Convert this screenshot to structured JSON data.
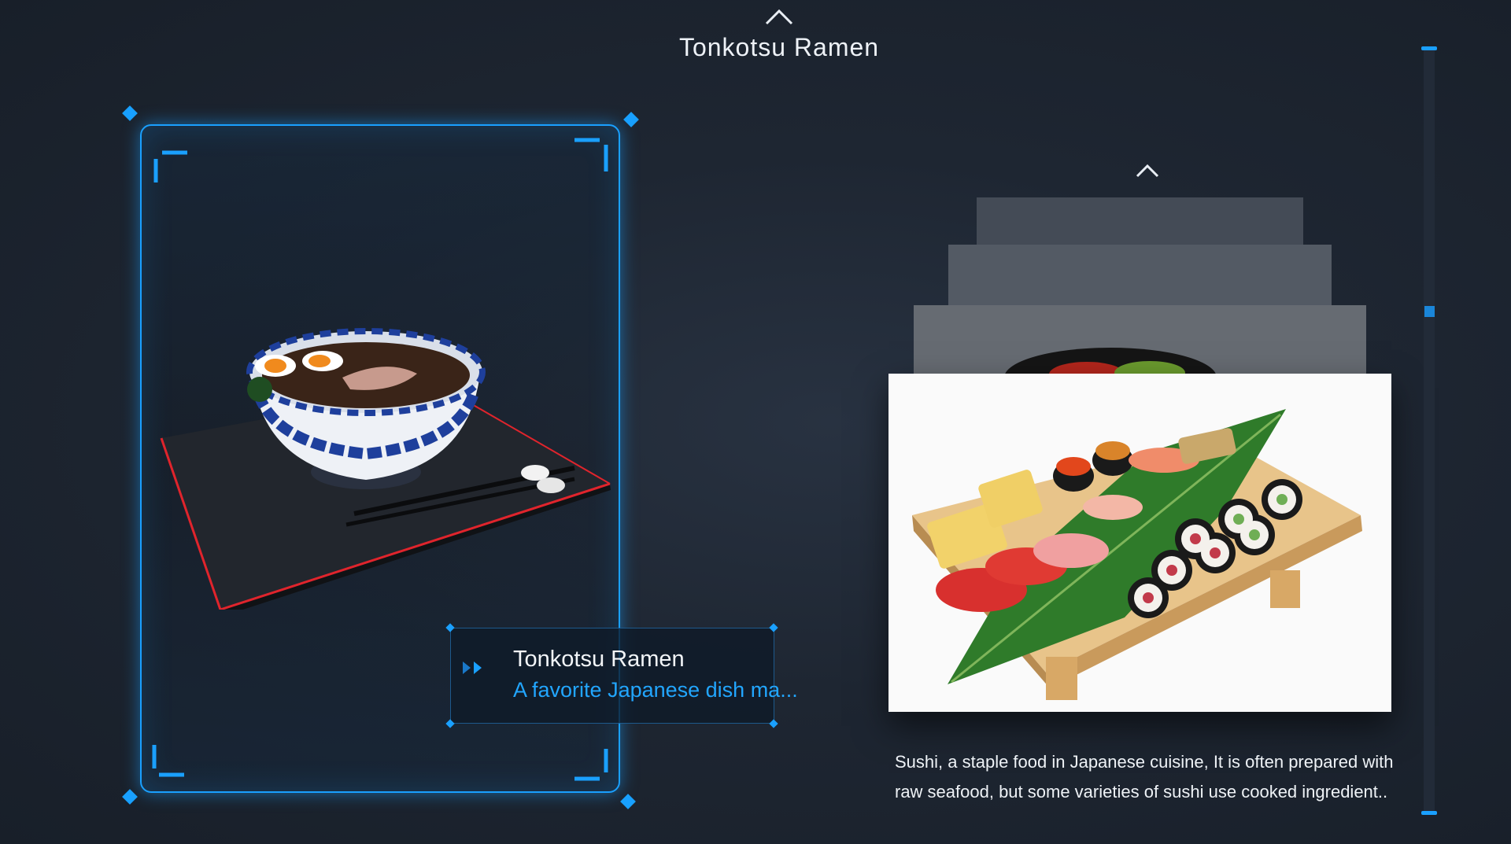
{
  "header": {
    "title": "Tonkotsu Ramen",
    "up_icon": "chevron-up-icon"
  },
  "featured_item": {
    "title": "Tonkotsu Ramen",
    "description": "A favorite Japanese dish ma...",
    "arrows_icon": "double-chevron-right-icon"
  },
  "carousel": {
    "up_icon": "chevron-up-icon",
    "active_card": {
      "caption": "Sushi, a staple food in Japanese cuisine, It is often prepared with raw seafood, but some varieties of sushi use cooked ingredient.."
    }
  },
  "scrollbar": {
    "position_fraction": 0.34
  },
  "colors": {
    "accent": "#1aa0ff",
    "background": "#1e2632",
    "link_text": "#22a6ff"
  }
}
